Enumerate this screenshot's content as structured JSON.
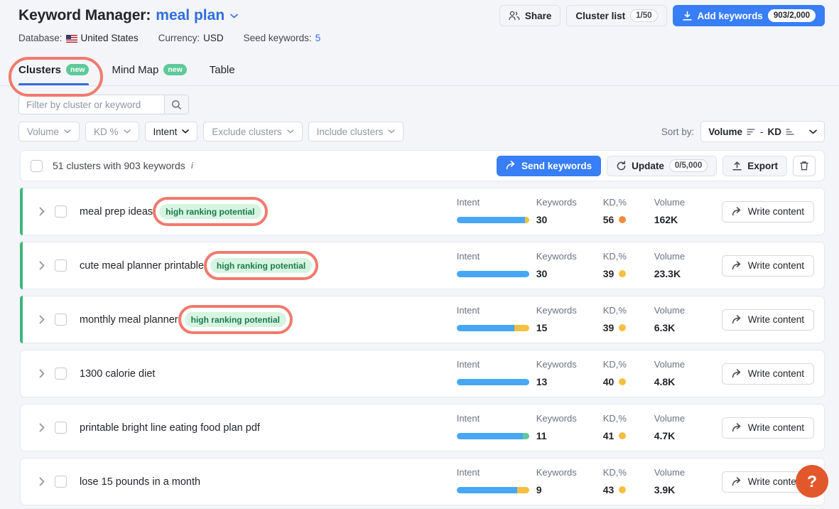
{
  "header": {
    "title_prefix": "Keyword Manager:",
    "entity": "meal plan",
    "caret_icon": "chevron-down-icon",
    "meta": [
      {
        "label": "Database:",
        "value": "United States",
        "flag": "us-flag-icon",
        "link": false
      },
      {
        "label": "Currency:",
        "value": "USD",
        "link": false
      },
      {
        "label": "Seed keywords:",
        "value": "5",
        "link": true
      }
    ],
    "actions": {
      "share_label": "Share",
      "share_icon": "share-people-icon",
      "cluster_list_label": "Cluster list",
      "cluster_list_count": "1/50",
      "add_keywords_label": "Add keywords",
      "add_keywords_icon": "download-icon",
      "add_keywords_count": "903/2,000"
    }
  },
  "tabs": [
    {
      "label": "Clusters",
      "badge": "new",
      "active": true
    },
    {
      "label": "Mind Map",
      "badge": "new",
      "active": false
    },
    {
      "label": "Table",
      "badge": "",
      "active": false
    }
  ],
  "filters": {
    "search_placeholder": "Filter by cluster or keyword",
    "search_value": "",
    "search_icon": "search-icon",
    "chips": [
      {
        "label": "Volume",
        "muted": true
      },
      {
        "label": "KD %",
        "muted": true
      },
      {
        "label": "Intent",
        "muted": false
      },
      {
        "label": "Exclude clusters",
        "muted": true
      },
      {
        "label": "Include clusters",
        "muted": true
      }
    ],
    "sort_label": "Sort by:",
    "sort_value_a": "Volume",
    "sort_separator": "-",
    "sort_value_b": "KD"
  },
  "toolbar": {
    "summary": "51 clusters with 903 keywords",
    "info_icon": "info-icon",
    "send_keywords_label": "Send keywords",
    "send_keywords_icon": "arrow-forward-icon",
    "update_label": "Update",
    "update_icon": "refresh-icon",
    "update_count": "0/5,000",
    "export_label": "Export",
    "export_icon": "upload-icon",
    "delete_icon": "trash-icon"
  },
  "columns": {
    "intent": "Intent",
    "keywords": "Keywords",
    "kd": "KD,%",
    "volume": "Volume"
  },
  "write_content_label": "Write content",
  "write_content_icon": "arrow-forward-icon",
  "high_ranking_tag": "high ranking potential",
  "colors": {
    "accent_blue": "#377ef7",
    "highlight_green": "#3cb77f",
    "tag_green_bg": "#d6f5e0",
    "tag_green_text": "#1c7a4d",
    "annotation_red": "#ef7b6e",
    "kd_orange": "#f08c3c",
    "kd_yellow": "#f5bf3f",
    "intent_informational": "#47a7f5",
    "intent_commercial": "#f5bf3f",
    "intent_navigational": "#5ec99a",
    "help_orange": "#e2582a"
  },
  "rows": [
    {
      "name": "meal prep ideas",
      "tag": "high ranking potential",
      "highlighted": true,
      "keywords": "30",
      "kd": "56",
      "kd_color": "#f08c3c",
      "volume": "162K",
      "intent_segments": [
        {
          "color": "#47a7f5",
          "pct": 94
        },
        {
          "color": "#f5bf3f",
          "pct": 6
        }
      ]
    },
    {
      "name": "cute meal planner printable",
      "tag": "high ranking potential",
      "highlighted": true,
      "keywords": "30",
      "kd": "39",
      "kd_color": "#f5bf3f",
      "volume": "23.3K",
      "intent_segments": [
        {
          "color": "#47a7f5",
          "pct": 100
        }
      ]
    },
    {
      "name": "monthly meal planner",
      "tag": "high ranking potential",
      "highlighted": true,
      "keywords": "15",
      "kd": "39",
      "kd_color": "#f5bf3f",
      "volume": "6.3K",
      "intent_segments": [
        {
          "color": "#47a7f5",
          "pct": 80
        },
        {
          "color": "#f5bf3f",
          "pct": 20
        }
      ]
    },
    {
      "name": "1300 calorie diet",
      "tag": "",
      "highlighted": false,
      "keywords": "13",
      "kd": "40",
      "kd_color": "#f5bf3f",
      "volume": "4.8K",
      "intent_segments": [
        {
          "color": "#47a7f5",
          "pct": 100
        }
      ]
    },
    {
      "name": "printable bright line eating food plan pdf",
      "tag": "",
      "highlighted": false,
      "keywords": "11",
      "kd": "41",
      "kd_color": "#f5bf3f",
      "volume": "4.7K",
      "intent_segments": [
        {
          "color": "#47a7f5",
          "pct": 91
        },
        {
          "color": "#5ec99a",
          "pct": 9
        }
      ]
    },
    {
      "name": "lose 15 pounds in a month",
      "tag": "",
      "highlighted": false,
      "keywords": "9",
      "kd": "43",
      "kd_color": "#f5bf3f",
      "volume": "3.9K",
      "intent_segments": [
        {
          "color": "#47a7f5",
          "pct": 84
        },
        {
          "color": "#f5bf3f",
          "pct": 16
        }
      ]
    }
  ],
  "help": {
    "icon": "question-mark-icon",
    "label": "?"
  }
}
